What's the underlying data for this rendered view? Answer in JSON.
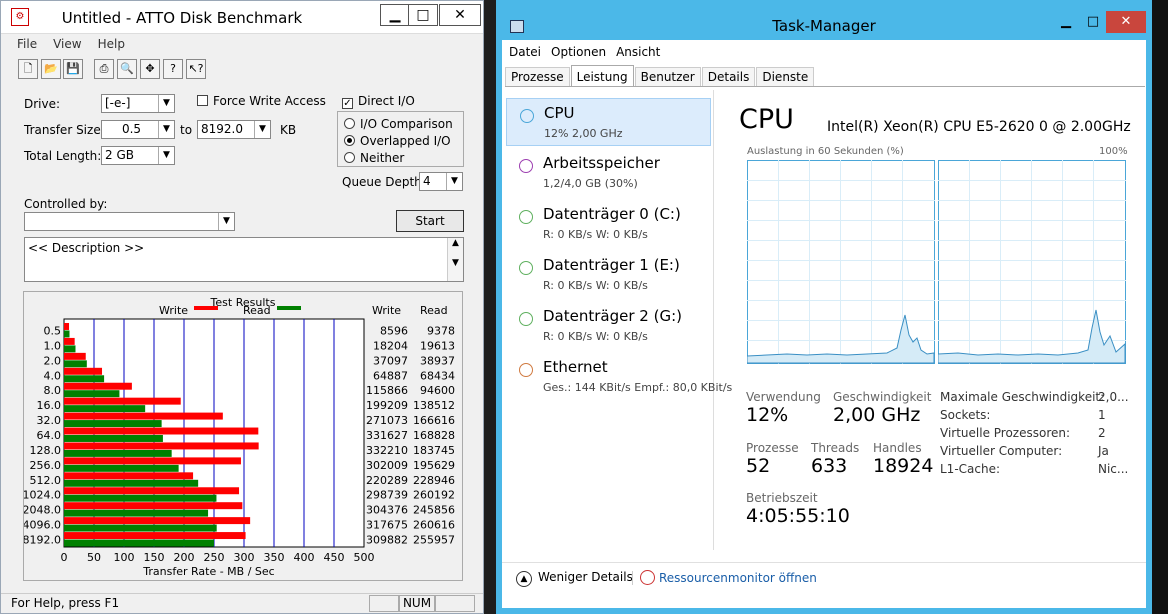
{
  "atto": {
    "title": "Untitled - ATTO Disk Benchmark",
    "menu": [
      "File",
      "View",
      "Help"
    ],
    "drive_label": "Drive:",
    "drive_value": "[-e-]",
    "force_write_label": "Force Write Access",
    "direct_io_label": "Direct I/O",
    "transfer_label": "Transfer Size:",
    "transfer_from": "0.5",
    "to_label": "to",
    "transfer_to": "8192.0",
    "kb": "KB",
    "total_label": "Total Length:",
    "total_value": "2 GB",
    "io_comparison": "I/O Comparison",
    "overlapped": "Overlapped I/O",
    "neither": "Neither",
    "queue_label": "Queue Depth:",
    "queue_value": "4",
    "controlled_label": "Controlled by:",
    "start_label": "Start",
    "description": "<< Description >>",
    "results_title": "Test Results",
    "write_label": "Write",
    "read_label": "Read",
    "col_write": "Write",
    "col_read": "Read",
    "xaxis_title": "Transfer Rate - MB / Sec",
    "status_text": "For Help, press F1",
    "status_num": "NUM"
  },
  "chart_data": {
    "type": "bar",
    "categories": [
      "0.5",
      "1.0",
      "2.0",
      "4.0",
      "8.0",
      "16.0",
      "32.0",
      "64.0",
      "128.0",
      "256.0",
      "512.0",
      "1024.0",
      "2048.0",
      "4096.0",
      "8192.0"
    ],
    "series": [
      {
        "name": "Write",
        "color": "#ff0000",
        "values": [
          8596,
          18204,
          37097,
          64887,
          115866,
          199209,
          271073,
          331627,
          332210,
          302009,
          220289,
          298739,
          304376,
          317675,
          309882
        ]
      },
      {
        "name": "Read",
        "color": "#008000",
        "values": [
          9378,
          19613,
          38937,
          68434,
          94600,
          138512,
          166616,
          168828,
          183745,
          195629,
          228946,
          260192,
          245856,
          260616,
          255957
        ]
      }
    ],
    "x_ticks": [
      "0",
      "50",
      "100",
      "150",
      "200",
      "250",
      "300",
      "350",
      "400",
      "450",
      "500"
    ],
    "xlim": [
      0,
      500
    ],
    "xlabel": "Transfer Rate - MB / Sec",
    "title": "Test Results"
  },
  "tm": {
    "title": "Task-Manager",
    "menu": [
      "Datei",
      "Optionen",
      "Ansicht"
    ],
    "tabs": [
      "Prozesse",
      "Leistung",
      "Benutzer",
      "Details",
      "Dienste"
    ],
    "side": [
      {
        "name": "CPU",
        "sub": "12%  2,00 GHz",
        "color": "#4aa6d8"
      },
      {
        "name": "Arbeitsspeicher",
        "sub": "1,2/4,0 GB (30%)",
        "color": "#9c3fb0"
      },
      {
        "name": "Datenträger 0 (C:)",
        "sub": "R: 0 KB/s W: 0 KB/s",
        "color": "#5fb05f"
      },
      {
        "name": "Datenträger 1 (E:)",
        "sub": "R: 0 KB/s W: 0 KB/s",
        "color": "#5fb05f"
      },
      {
        "name": "Datenträger 2 (G:)",
        "sub": "R: 0 KB/s W: 0 KB/s",
        "color": "#5fb05f"
      },
      {
        "name": "Ethernet",
        "sub": "Ges.: 144 KBit/s Empf.: 80,0 KBit/s",
        "color": "#d07a40"
      }
    ],
    "cpu_heading": "CPU",
    "cpu_model": "Intel(R) Xeon(R) CPU E5-2620 0 @ 2.00GHz",
    "graph_label": "Auslastung in 60 Sekunden (%)",
    "graph_max": "100%",
    "verwendung_k": "Verwendung",
    "verwendung_v": "12%",
    "geschw_k": "Geschwindigkeit",
    "geschw_v": "2,00 GHz",
    "prozesse_k": "Prozesse",
    "prozesse_v": "52",
    "threads_k": "Threads",
    "threads_v": "633",
    "handles_k": "Handles",
    "handles_v": "18924",
    "betrieb_k": "Betriebszeit",
    "betrieb_v": "4:05:55:10",
    "details": [
      {
        "k": "Maximale Geschwindigkeit:",
        "v": "2,0..."
      },
      {
        "k": "Sockets:",
        "v": "1"
      },
      {
        "k": "Virtuelle Prozessoren:",
        "v": "2"
      },
      {
        "k": "Virtueller Computer:",
        "v": "Ja"
      },
      {
        "k": "L1-Cache:",
        "v": "Nic..."
      }
    ],
    "fewer_details": "Weniger Details",
    "resmon": "Ressourcenmonitor öffnen"
  }
}
